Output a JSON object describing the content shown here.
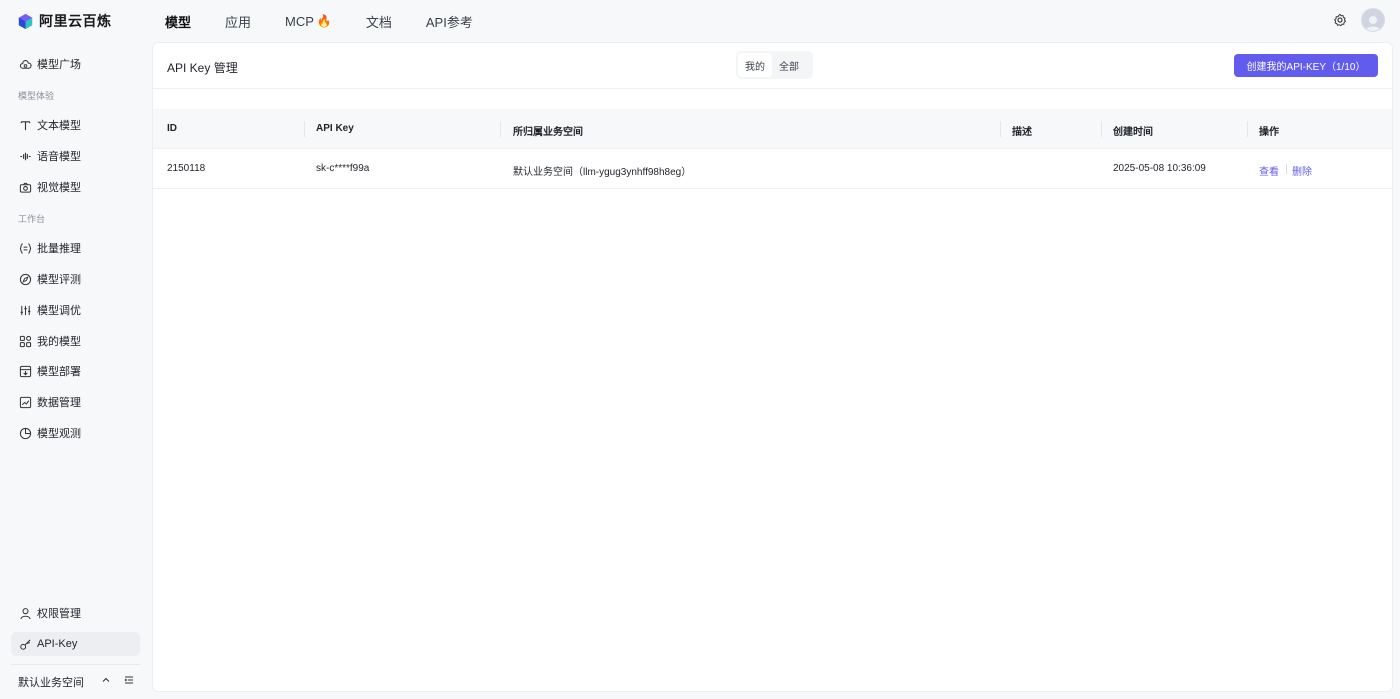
{
  "app": {
    "name": "阿里云百炼"
  },
  "topnav": [
    {
      "label": "模型",
      "active": true
    },
    {
      "label": "应用"
    },
    {
      "label": "MCP",
      "badge": "🔥"
    },
    {
      "label": "文档"
    },
    {
      "label": "API参考"
    }
  ],
  "sidebar": {
    "items": [
      {
        "label": "模型广场",
        "icon": "cloud-icon"
      },
      {
        "label": "文本模型",
        "icon": "text-icon"
      },
      {
        "label": "语音模型",
        "icon": "waveform-icon"
      },
      {
        "label": "视觉模型",
        "icon": "camera-icon"
      },
      {
        "label": "批量推理",
        "icon": "batch-icon"
      },
      {
        "label": "模型评测",
        "icon": "compass-icon"
      },
      {
        "label": "模型调优",
        "icon": "sliders-icon"
      },
      {
        "label": "我的模型",
        "icon": "grid-icon"
      },
      {
        "label": "模型部署",
        "icon": "deploy-icon"
      },
      {
        "label": "数据管理",
        "icon": "chart-icon"
      },
      {
        "label": "模型观测",
        "icon": "pie-icon"
      },
      {
        "label": "权限管理",
        "icon": "user-icon"
      },
      {
        "label": "API-Key",
        "icon": "key-icon",
        "active": true
      }
    ],
    "sections": {
      "experience": "模型体验",
      "workbench": "工作台"
    },
    "workspace": "默认业务空间"
  },
  "panel": {
    "title": "API Key 管理",
    "segments": [
      {
        "label": "我的",
        "active": true
      },
      {
        "label": "全部"
      }
    ],
    "create_button": "创建我的API-KEY（1/10）"
  },
  "table": {
    "columns": [
      "ID",
      "API Key",
      "所归属业务空间",
      "描述",
      "创建时间",
      "操作"
    ],
    "rows": [
      {
        "id": "2150118",
        "api_key": "sk-c****f99a",
        "workspace": "默认业务空间（llm-ygug3ynhff98h8eg）",
        "description": "",
        "created": "2025-05-08 10:36:09",
        "actions": [
          "查看",
          "删除"
        ]
      }
    ]
  },
  "colors": {
    "accent": "#615ced",
    "background": "#f7f8fa"
  }
}
